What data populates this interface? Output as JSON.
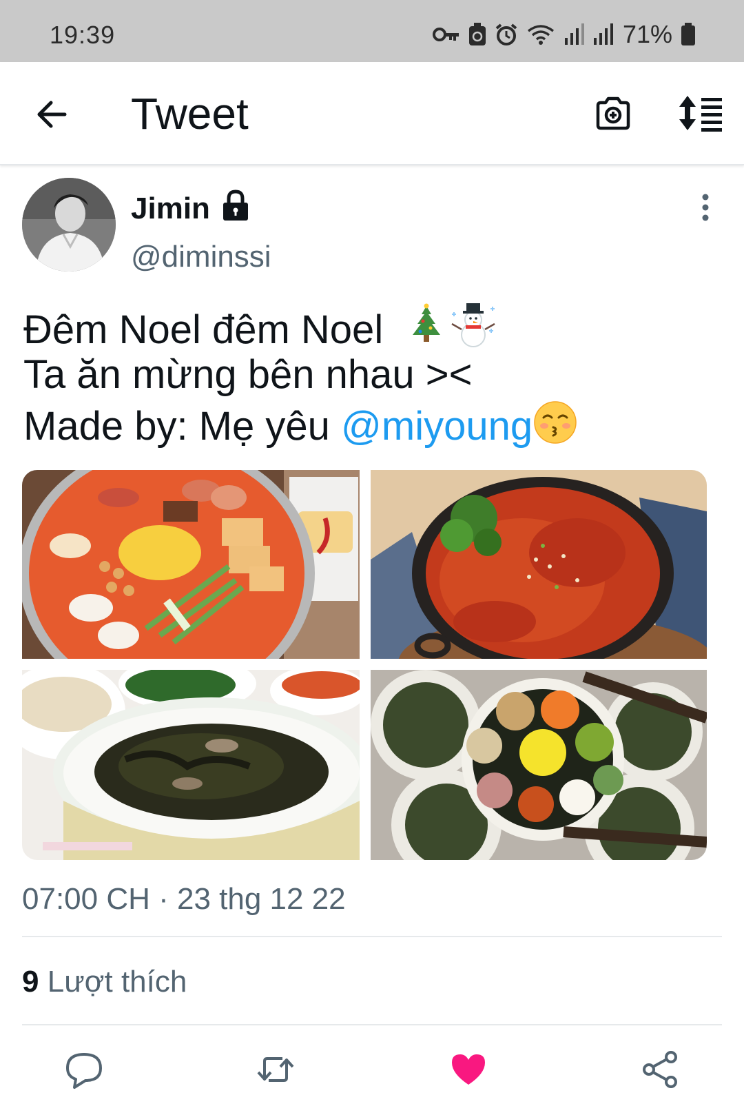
{
  "status_bar": {
    "time": "19:39",
    "battery_percent": "71%"
  },
  "app_bar": {
    "title": "Tweet"
  },
  "author": {
    "name": "Jimin",
    "handle": "@diminssi"
  },
  "tweet": {
    "line1": "Đêm Noel đêm Noel",
    "line2": "Ta ăn mừng bên nhau ><",
    "line3_prefix": "Made by: Mẹ yêu ",
    "mention": "@miyoung",
    "emoji_icons": [
      "christmas-tree-icon",
      "snowman-icon",
      "kissing-face-icon"
    ]
  },
  "media": [
    {
      "name": "budae-jjigae-photo"
    },
    {
      "name": "spicy-pork-skillet-photo"
    },
    {
      "name": "seaweed-soup-photo"
    },
    {
      "name": "kimbap-photo"
    }
  ],
  "meta": {
    "timestamp": "07:00 CH · 23 thg 12 22"
  },
  "stats": {
    "like_count": "9",
    "like_label": "Lượt thích"
  },
  "actions": [
    {
      "name": "reply-icon"
    },
    {
      "name": "retweet-icon"
    },
    {
      "name": "like-icon",
      "active": true
    },
    {
      "name": "share-icon"
    }
  ],
  "colors": {
    "accent": "#1d9bf0",
    "like": "#f91880",
    "secondary_text": "#536471"
  }
}
